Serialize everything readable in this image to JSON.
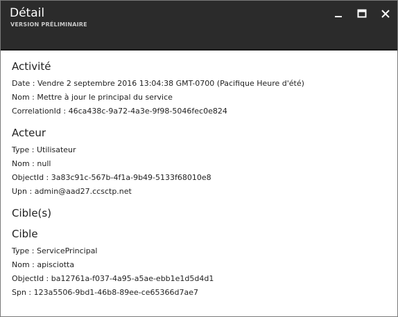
{
  "header": {
    "title": "Détail",
    "subtitle": "VERSION PRÉLIMINAIRE",
    "controls": [
      "minimize-icon",
      "maximize-icon",
      "close-icon"
    ]
  },
  "activity": {
    "heading": "Activité",
    "date": "Date : Vendre 2 septembre 2016 13:04:38 GMT-0700 (Pacifique Heure d'été)",
    "name": "Nom : Mettre à jour le principal du service",
    "correlation": "CorrelationId : 46ca438c-9a72-4a3e-9f98-5046fec0e824"
  },
  "actor": {
    "heading": "Acteur",
    "type": "Type : Utilisateur",
    "name": "Nom : null",
    "objectid": "ObjectId : 3a83c91c-567b-4f1a-9b49-5133f68010e8",
    "upn": "Upn : admin@aad27.ccsctp.net"
  },
  "targets": {
    "heading": "Cible(s)",
    "target_heading": "Cible",
    "type": "Type : ServicePrincipal",
    "name": "Nom : apisciotta",
    "objectid": "ObjectId : ba12761a-f037-4a95-a5ae-ebb1e1d5d4d1",
    "spn": "Spn : 123a5506-9bd1-46b8-89ee-ce65366d7ae7"
  }
}
